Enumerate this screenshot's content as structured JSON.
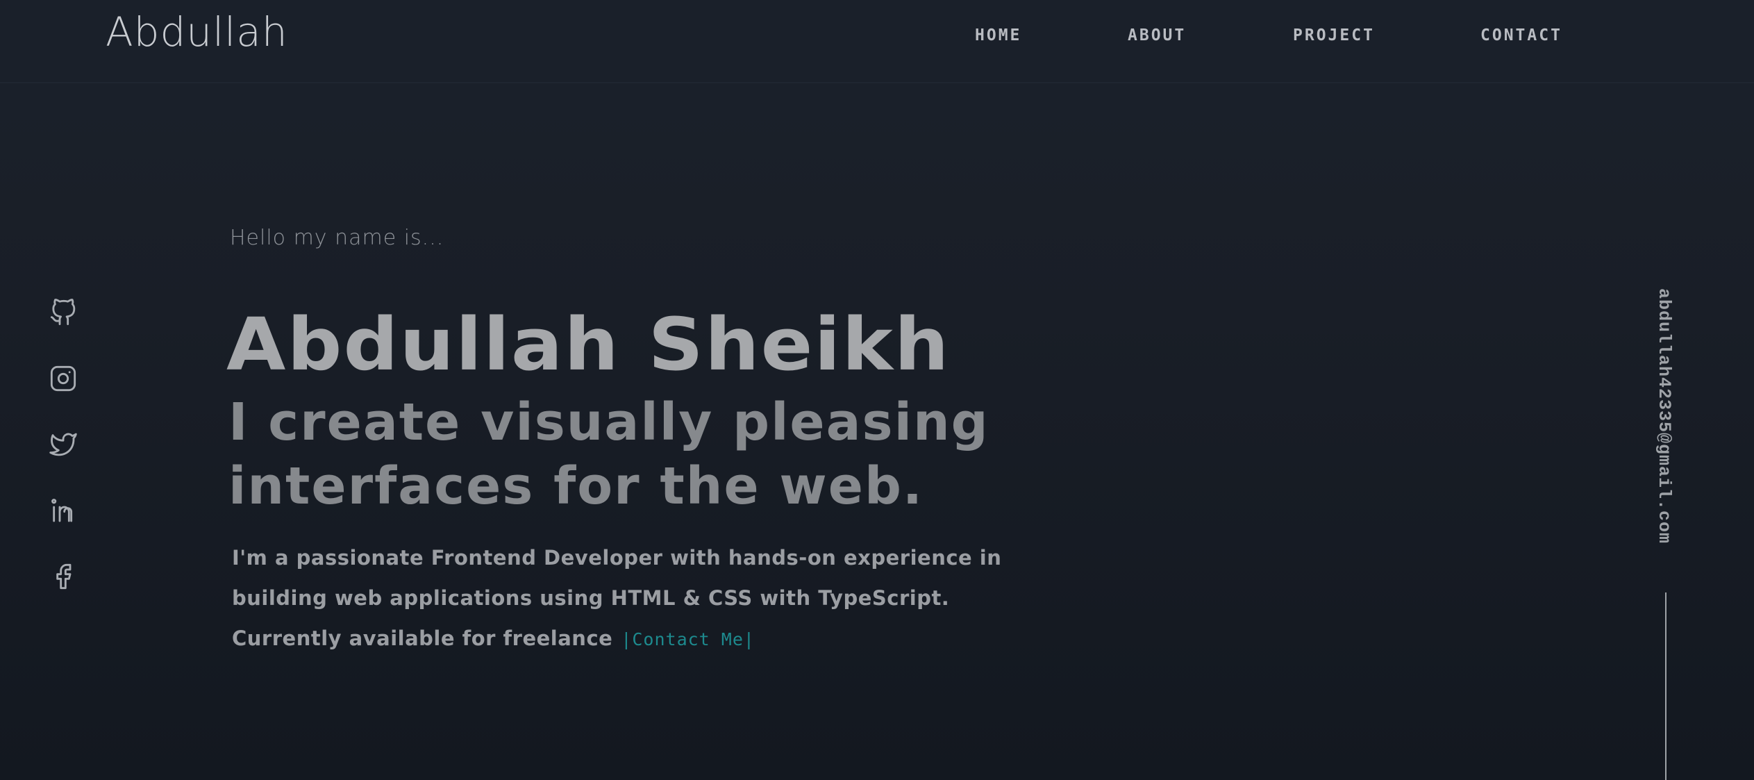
{
  "header": {
    "logo": "Abdullah",
    "nav": [
      {
        "label": "HOME"
      },
      {
        "label": "ABOUT"
      },
      {
        "label": "PROJECT"
      },
      {
        "label": "CONTACT"
      }
    ]
  },
  "social": {
    "icons": [
      "github-icon",
      "instagram-icon",
      "twitter-icon",
      "linkedin-icon",
      "facebook-icon"
    ]
  },
  "hero": {
    "greeting": "Hello my name is...",
    "name": "Abdullah Sheikh",
    "tagline_line1": "I create visually pleasing",
    "tagline_line2": "interfaces for the web.",
    "desc_line1": "I'm a passionate Frontend Developer with hands-on experience in",
    "desc_line2": "building web applications using HTML & CSS with TypeScript.",
    "desc_line3": "Currently available for freelance",
    "contact_link": "|Contact Me|"
  },
  "email": "abdullah42335@gmail.com",
  "colors": {
    "background": "#191e27",
    "accent": "#1d8a8e",
    "text": "#a6a8ab"
  }
}
